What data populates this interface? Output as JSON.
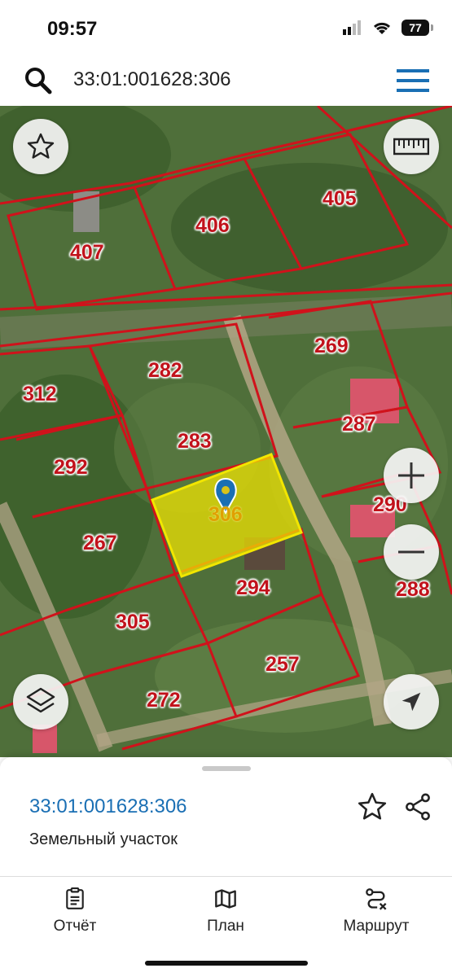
{
  "status_bar": {
    "time": "09:57",
    "battery": "77"
  },
  "search": {
    "query": "33:01:001628:306"
  },
  "map": {
    "parcels": [
      {
        "label": "405"
      },
      {
        "label": "406"
      },
      {
        "label": "407"
      },
      {
        "label": "269"
      },
      {
        "label": "282"
      },
      {
        "label": "312"
      },
      {
        "label": "283"
      },
      {
        "label": "287"
      },
      {
        "label": "292"
      },
      {
        "label": "306",
        "selected": true
      },
      {
        "label": "290"
      },
      {
        "label": "267"
      },
      {
        "label": "294"
      },
      {
        "label": "288"
      },
      {
        "label": "305"
      },
      {
        "label": "257"
      },
      {
        "label": "272"
      }
    ],
    "colors": {
      "boundary": "#d0121b",
      "highlight": "#f2e600",
      "label_text": "#c1121b"
    }
  },
  "icons": {
    "favorite": "star-icon",
    "ruler": "ruler-icon",
    "zoom_in": "plus-icon",
    "zoom_out": "minus-icon",
    "layers": "layers-icon",
    "locate": "location-arrow-icon"
  },
  "sheet": {
    "cadastral_number": "33:01:001628:306",
    "object_type": "Земельный участок",
    "tabs": [
      {
        "label": "Отчёт"
      },
      {
        "label": "План"
      },
      {
        "label": "Маршрут"
      }
    ]
  }
}
